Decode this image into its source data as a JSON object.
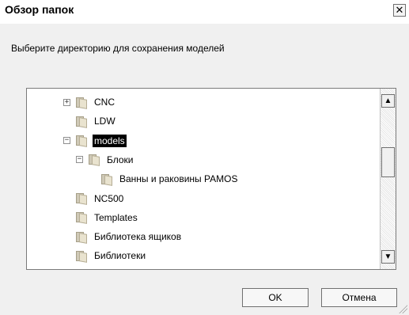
{
  "window": {
    "title": "Обзор папок",
    "close_label": "✕"
  },
  "prompt": "Выберите директорию для сохранения моделей",
  "tree": {
    "items": [
      {
        "label": "CNC",
        "expander": "+",
        "level": 0,
        "selected": false
      },
      {
        "label": "LDW",
        "expander": "",
        "level": 0,
        "selected": false
      },
      {
        "label": "models",
        "expander": "−",
        "level": 0,
        "selected": true
      },
      {
        "label": "Блоки",
        "expander": "−",
        "level": 1,
        "selected": false
      },
      {
        "label": "Ванны и раковины PAMOS",
        "expander": "",
        "level": 2,
        "selected": false
      },
      {
        "label": "NC500",
        "expander": "",
        "level": 0,
        "selected": false
      },
      {
        "label": "Templates",
        "expander": "",
        "level": 0,
        "selected": false
      },
      {
        "label": "Библиотека ящиков",
        "expander": "",
        "level": 0,
        "selected": false
      },
      {
        "label": "Библиотеки",
        "expander": "",
        "level": 0,
        "selected": false
      }
    ]
  },
  "buttons": {
    "ok": "OK",
    "cancel": "Отмена"
  },
  "scrollbar": {
    "up_label": "▲",
    "down_label": "▼"
  }
}
